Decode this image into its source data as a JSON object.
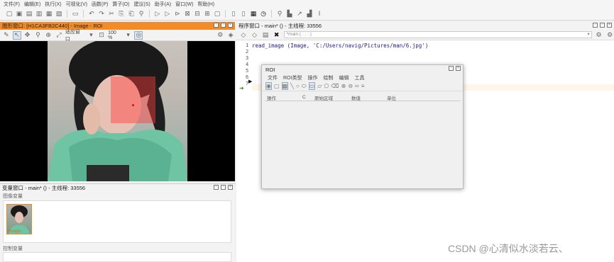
{
  "menu": [
    "文件(F)",
    "编辑(E)",
    "执行(X)",
    "可视化(V)",
    "函数(P)",
    "算子(O)",
    "建议(S)",
    "助手(A)",
    "窗口(W)",
    "帮助(H)"
  ],
  "graphics_window": {
    "title": "图形窗口: [H1CA3FB2C440] - Image - ROI",
    "fit_label": "适应窗口",
    "zoom": "100 %"
  },
  "variable_window": {
    "title": "变量窗口 - main* () - 主线程: 33556",
    "image_vars_label": "图像变量",
    "image_var_name": "Image",
    "control_vars_label": "控制变量"
  },
  "program_window": {
    "title": "程序窗口 - main* () - 主线程: 33556",
    "procedure": "*main ( : : : )",
    "code_lines": [
      "read_image (Image, 'C:/Users/navig/Pictures/man/6.jpg')",
      "",
      "",
      "",
      "",
      "",
      ""
    ],
    "line_numbers": [
      "1",
      "2",
      "3",
      "4",
      "5",
      "6",
      "7"
    ]
  },
  "roi_dialog": {
    "title": "ROI",
    "menu": [
      "文件",
      "ROI类型",
      "操作",
      "绘制",
      "编辑",
      "工具"
    ],
    "columns": [
      "操作",
      "C",
      "原始区域",
      "数值",
      "单位"
    ]
  },
  "watermark": "CSDN @心清似水淡若云、"
}
